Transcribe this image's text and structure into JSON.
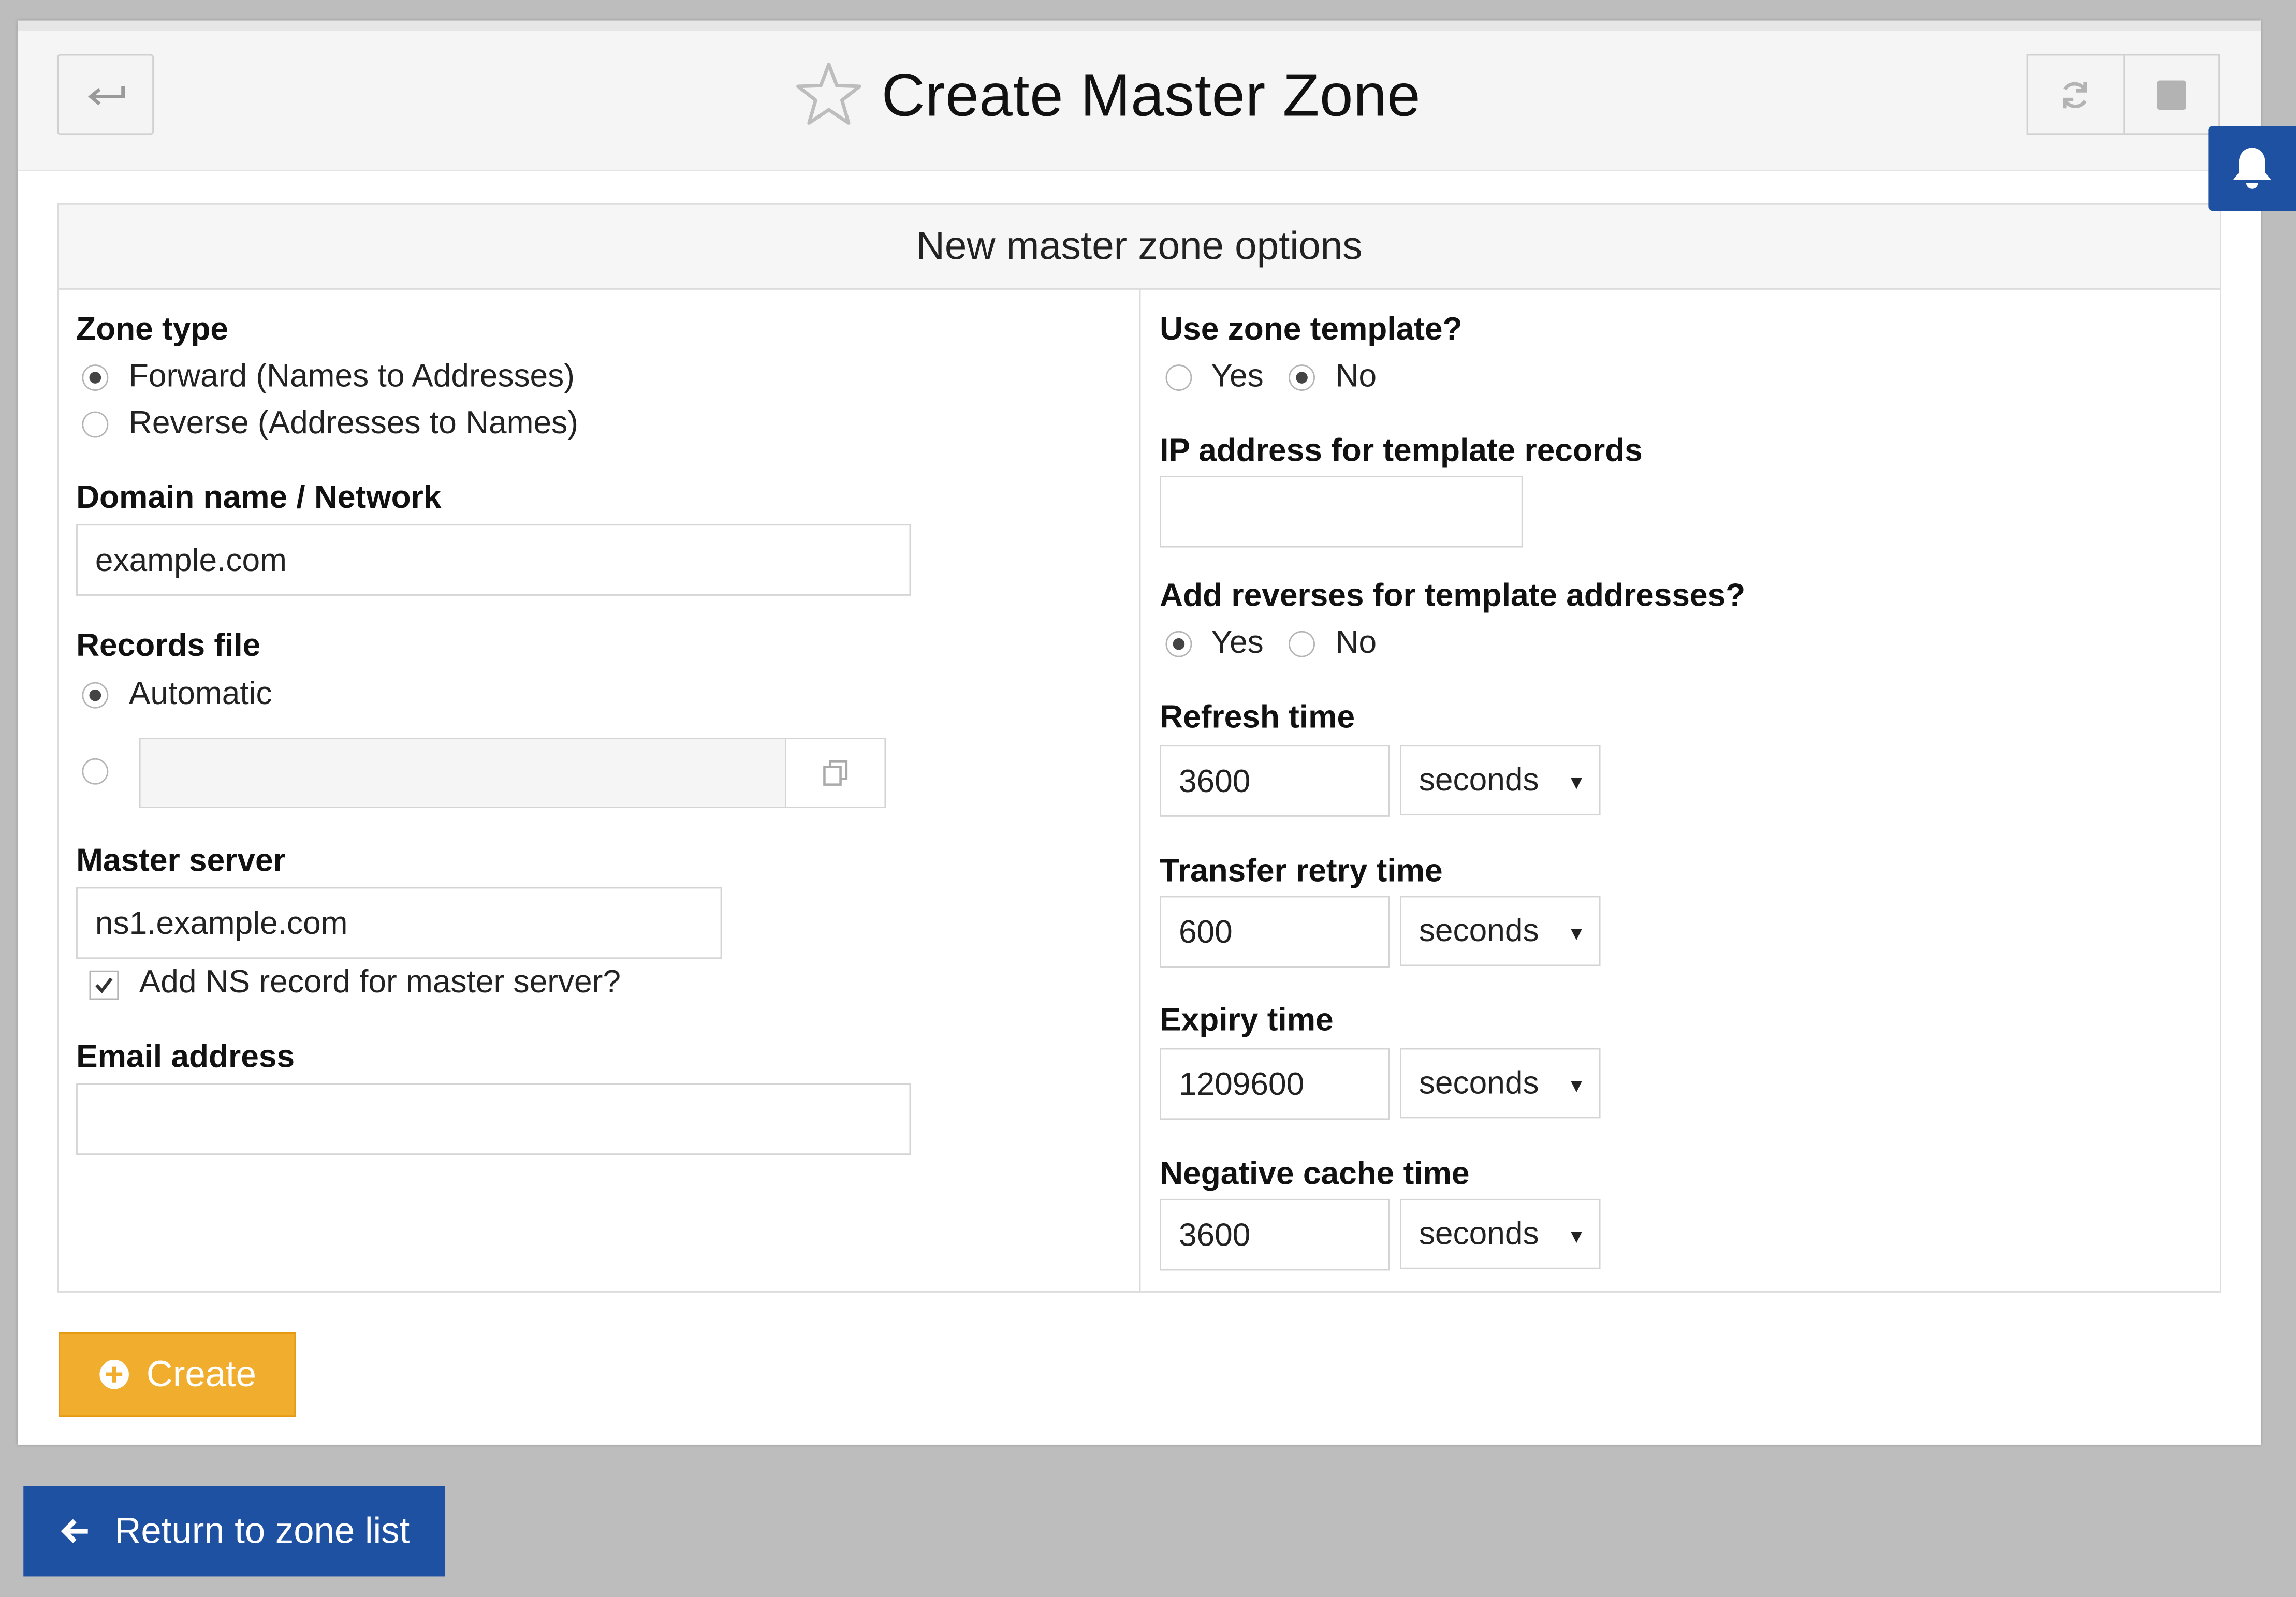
{
  "header": {
    "title": "Create Master Zone"
  },
  "section": {
    "title": "New master zone options"
  },
  "left": {
    "zone_type": {
      "label": "Zone type",
      "options": [
        {
          "label": "Forward (Names to Addresses)",
          "selected": true
        },
        {
          "label": "Reverse (Addresses to Names)",
          "selected": false
        }
      ]
    },
    "domain": {
      "label": "Domain name / Network",
      "value": "example.com"
    },
    "records_file": {
      "label": "Records file",
      "automatic_label": "Automatic",
      "automatic_selected": true,
      "custom_value": ""
    },
    "master_server": {
      "label": "Master server",
      "value": "ns1.example.com",
      "add_ns_label": "Add NS record for master server?",
      "add_ns_checked": true
    },
    "email": {
      "label": "Email address",
      "value": ""
    }
  },
  "right": {
    "use_template": {
      "label": "Use zone template?",
      "yes": "Yes",
      "no": "No",
      "selected": "No"
    },
    "ip_template": {
      "label": "IP address for template records",
      "value": ""
    },
    "add_reverses": {
      "label": "Add reverses for template addresses?",
      "yes": "Yes",
      "no": "No",
      "selected": "Yes"
    },
    "refresh": {
      "label": "Refresh time",
      "value": "3600",
      "unit": "seconds"
    },
    "retry": {
      "label": "Transfer retry time",
      "value": "600",
      "unit": "seconds"
    },
    "expiry": {
      "label": "Expiry time",
      "value": "1209600",
      "unit": "seconds"
    },
    "negative": {
      "label": "Negative cache time",
      "value": "3600",
      "unit": "seconds"
    }
  },
  "actions": {
    "create_label": "Create",
    "return_label": "Return to zone list"
  },
  "colors": {
    "create_button": "#f0ad2e",
    "return_button": "#1f51a3",
    "notification_button": "#1f51a3"
  }
}
